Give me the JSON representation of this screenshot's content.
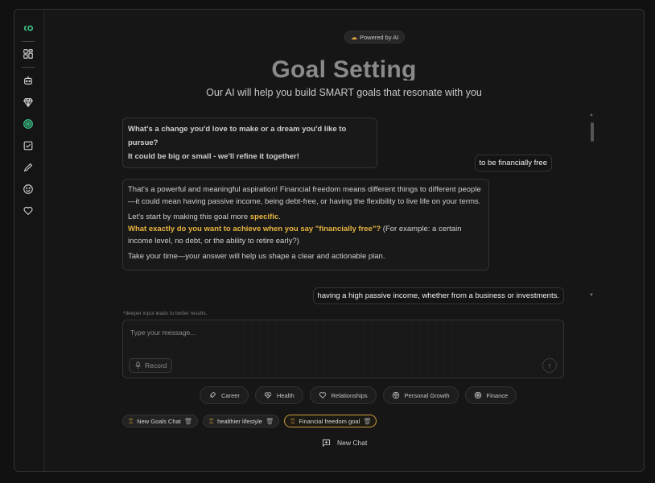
{
  "badge": {
    "label": "Powered by AI",
    "icon": "sparkle-icon"
  },
  "header": {
    "title": "Goal Setting",
    "subtitle": "Our AI will help you build SMART goals that resonate with you"
  },
  "sidebar": {
    "items": [
      "logo-icon",
      "dashboard-icon",
      "bot-icon",
      "gem-icon",
      "target-icon",
      "checklist-icon",
      "pencil-icon",
      "smile-icon",
      "heart-icon"
    ],
    "active_color": "#3ecf8e"
  },
  "messages": {
    "ai_1_line1": "What's a change you'd love to make or a dream you'd like to pursue?",
    "ai_1_line2": "It could be big or small - we'll refine it together!",
    "user_1": "to be financially free",
    "ai_2_p1": "That's a powerful and meaningful aspiration! Financial freedom means different things to different people—it could mean having passive income, being debt-free, or having the flexibility to live life on your terms.",
    "ai_2_p2_prefix": "Let's start by making this goal more ",
    "ai_2_p2_highlight": "specific",
    "ai_2_p2_suffix": ".",
    "ai_2_p3_highlight": "What exactly do you want to achieve when you say \"financially free\"?",
    "ai_2_p3_rest": " (For example: a certain income level, no debt, or the ability to retire early?)",
    "ai_2_p4": "Take your time—your answer will help us shape a clear and actionable plan.",
    "user_2": "having a high passive income, whether from a business or investments."
  },
  "input": {
    "hint": "*deeper input leads to better results.",
    "placeholder": "Type your message...",
    "record_label": "Record"
  },
  "categories": [
    {
      "label": "Career",
      "icon": "rocket-icon"
    },
    {
      "label": "Health",
      "icon": "heart-pulse-icon"
    },
    {
      "label": "Relationships",
      "icon": "heart-icon"
    },
    {
      "label": "Personal Growth",
      "icon": "brain-icon"
    },
    {
      "label": "Finance",
      "icon": "target-icon"
    }
  ],
  "goals": [
    {
      "label": "New Goals Chat",
      "active": false
    },
    {
      "label": "healthier lifestyle",
      "active": false
    },
    {
      "label": "Financial freedom goal",
      "active": true
    }
  ],
  "new_chat_label": "New Chat",
  "colors": {
    "accent": "#e8b43e",
    "active_goal_border": "#c99a3a",
    "background": "#161616"
  }
}
